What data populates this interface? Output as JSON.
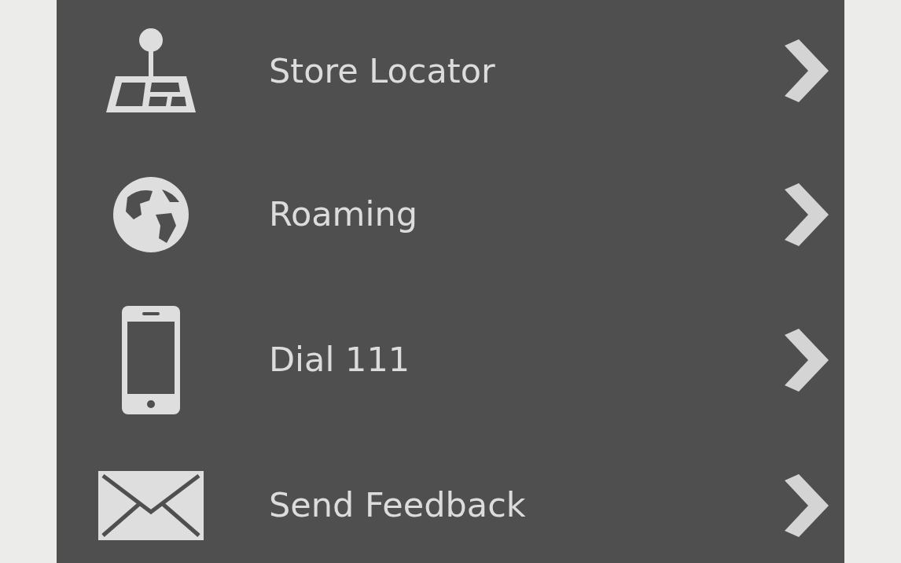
{
  "menu": {
    "items": [
      {
        "label": "Store Locator",
        "kind": "locator"
      },
      {
        "label": "Roaming",
        "kind": "globe"
      },
      {
        "label": "Dial 111",
        "kind": "phone"
      },
      {
        "label": "Send Feedback",
        "kind": "mail"
      }
    ]
  }
}
